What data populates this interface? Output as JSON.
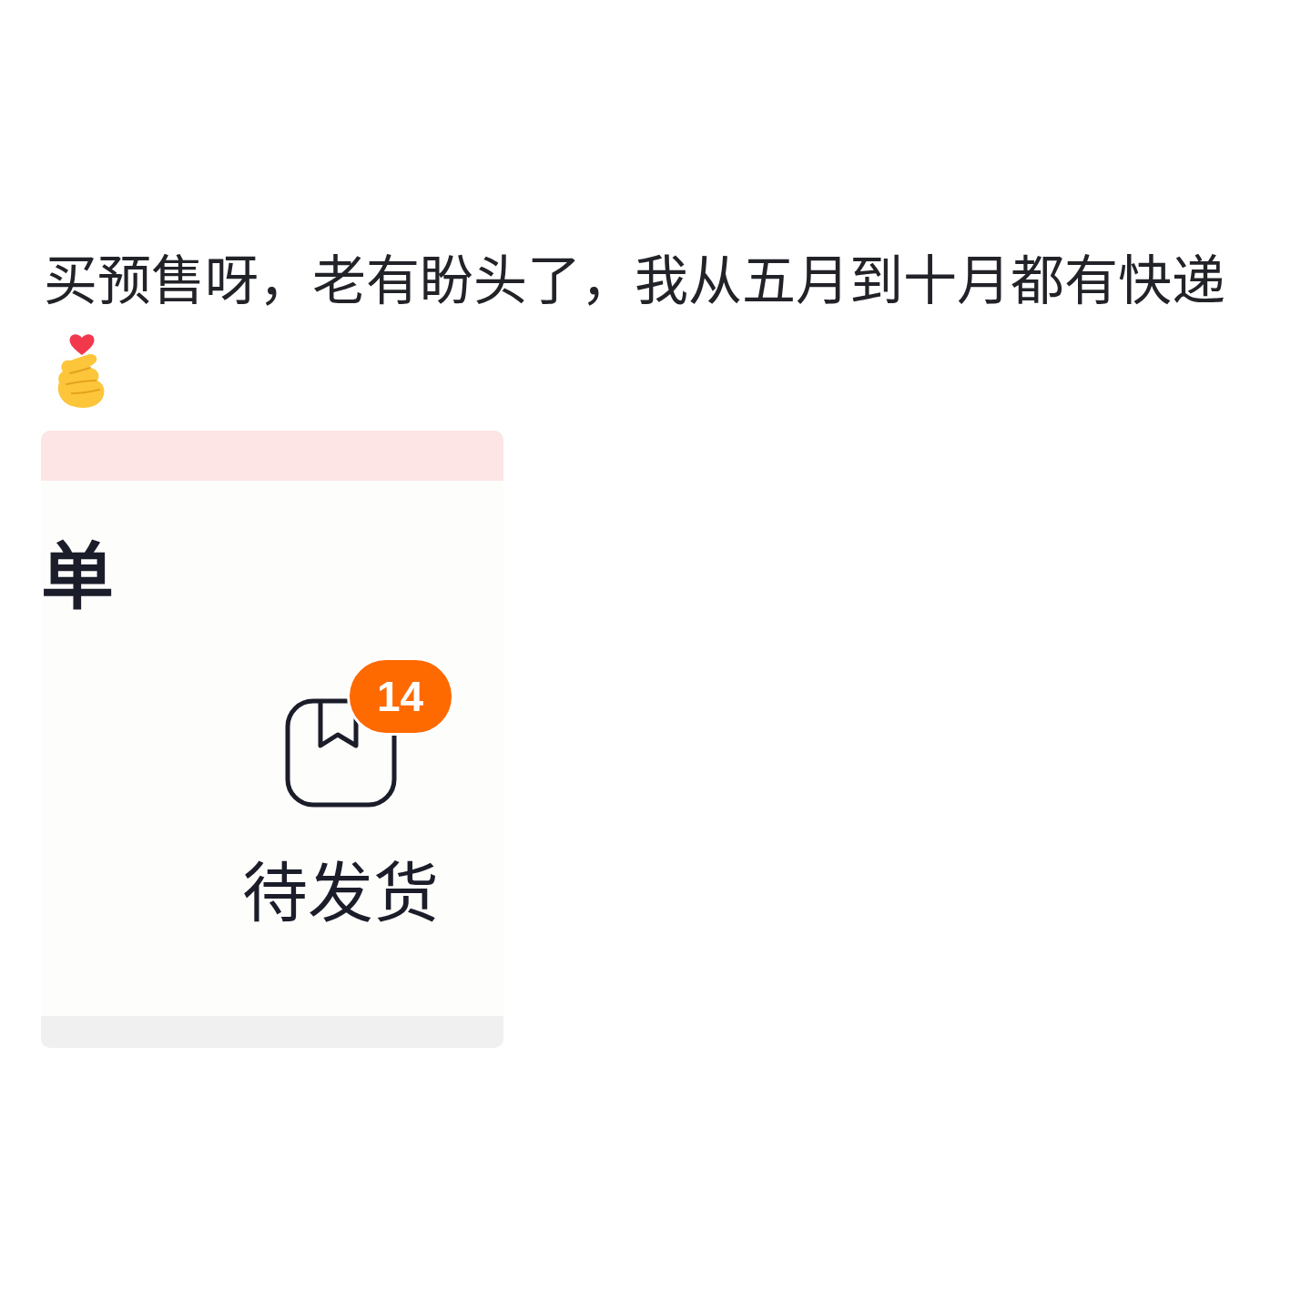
{
  "post": {
    "text": "买预售呀，老有盼头了，我从五月到十月都有快递"
  },
  "screenshot": {
    "heading": "单",
    "order_status": {
      "label": "待发货",
      "badge": "14"
    }
  }
}
